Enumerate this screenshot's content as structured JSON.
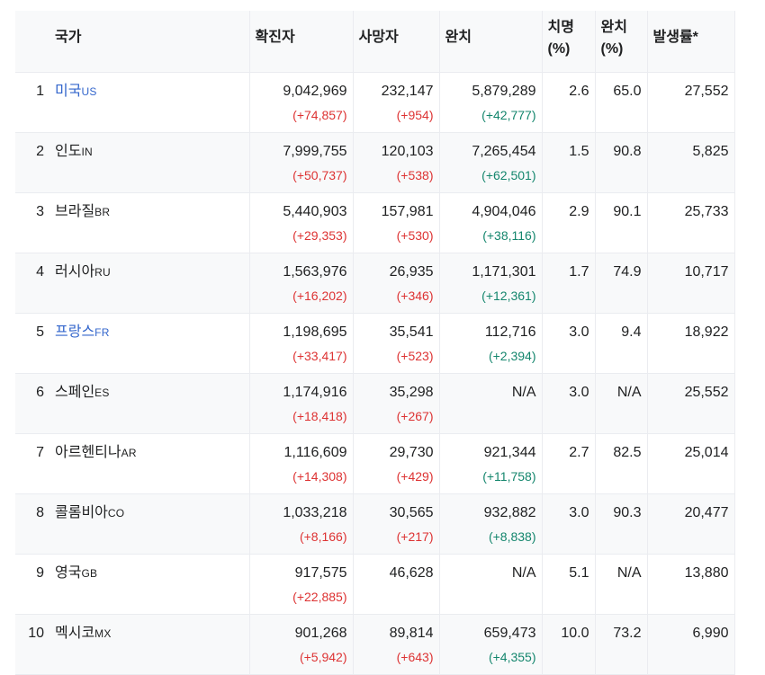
{
  "headers": {
    "country": "국가",
    "confirmed": "확진자",
    "deaths": "사망자",
    "recovered": "완치",
    "fatality_line1": "치명",
    "fatality_line2": "(%)",
    "recovery_line1": "완치",
    "recovery_line2": "(%)",
    "incidence": "발생률*"
  },
  "rows": [
    {
      "rank": "1",
      "name": "미국",
      "code": "US",
      "link": true,
      "confirmed": "9,042,969",
      "confirmed_delta": "(+74,857)",
      "deaths": "232,147",
      "deaths_delta": "(+954)",
      "recovered": "5,879,289",
      "recovered_delta": "(+42,777)",
      "fatality": "2.6",
      "recovery_rate": "65.0",
      "incidence": "27,552"
    },
    {
      "rank": "2",
      "name": "인도",
      "code": "IN",
      "link": false,
      "confirmed": "7,999,755",
      "confirmed_delta": "(+50,737)",
      "deaths": "120,103",
      "deaths_delta": "(+538)",
      "recovered": "7,265,454",
      "recovered_delta": "(+62,501)",
      "fatality": "1.5",
      "recovery_rate": "90.8",
      "incidence": "5,825"
    },
    {
      "rank": "3",
      "name": "브라질",
      "code": "BR",
      "link": false,
      "confirmed": "5,440,903",
      "confirmed_delta": "(+29,353)",
      "deaths": "157,981",
      "deaths_delta": "(+530)",
      "recovered": "4,904,046",
      "recovered_delta": "(+38,116)",
      "fatality": "2.9",
      "recovery_rate": "90.1",
      "incidence": "25,733"
    },
    {
      "rank": "4",
      "name": "러시아",
      "code": "RU",
      "link": false,
      "confirmed": "1,563,976",
      "confirmed_delta": "(+16,202)",
      "deaths": "26,935",
      "deaths_delta": "(+346)",
      "recovered": "1,171,301",
      "recovered_delta": "(+12,361)",
      "fatality": "1.7",
      "recovery_rate": "74.9",
      "incidence": "10,717"
    },
    {
      "rank": "5",
      "name": "프랑스",
      "code": "FR",
      "link": true,
      "confirmed": "1,198,695",
      "confirmed_delta": "(+33,417)",
      "deaths": "35,541",
      "deaths_delta": "(+523)",
      "recovered": "112,716",
      "recovered_delta": "(+2,394)",
      "fatality": "3.0",
      "recovery_rate": "9.4",
      "incidence": "18,922"
    },
    {
      "rank": "6",
      "name": "스페인",
      "code": "ES",
      "link": false,
      "confirmed": "1,174,916",
      "confirmed_delta": "(+18,418)",
      "deaths": "35,298",
      "deaths_delta": "(+267)",
      "recovered": "N/A",
      "recovered_delta": "",
      "fatality": "3.0",
      "recovery_rate": "N/A",
      "incidence": "25,552"
    },
    {
      "rank": "7",
      "name": "아르헨티나",
      "code": "AR",
      "link": false,
      "confirmed": "1,116,609",
      "confirmed_delta": "(+14,308)",
      "deaths": "29,730",
      "deaths_delta": "(+429)",
      "recovered": "921,344",
      "recovered_delta": "(+11,758)",
      "fatality": "2.7",
      "recovery_rate": "82.5",
      "incidence": "25,014"
    },
    {
      "rank": "8",
      "name": "콜롬비아",
      "code": "CO",
      "link": false,
      "confirmed": "1,033,218",
      "confirmed_delta": "(+8,166)",
      "deaths": "30,565",
      "deaths_delta": "(+217)",
      "recovered": "932,882",
      "recovered_delta": "(+8,838)",
      "fatality": "3.0",
      "recovery_rate": "90.3",
      "incidence": "20,477"
    },
    {
      "rank": "9",
      "name": "영국",
      "code": "GB",
      "link": false,
      "confirmed": "917,575",
      "confirmed_delta": "(+22,885)",
      "deaths": "46,628",
      "deaths_delta": "",
      "recovered": "N/A",
      "recovered_delta": "",
      "fatality": "5.1",
      "recovery_rate": "N/A",
      "incidence": "13,880"
    },
    {
      "rank": "10",
      "name": "멕시코",
      "code": "MX",
      "link": false,
      "confirmed": "901,268",
      "confirmed_delta": "(+5,942)",
      "deaths": "89,814",
      "deaths_delta": "(+643)",
      "recovered": "659,473",
      "recovered_delta": "(+4,355)",
      "fatality": "10.0",
      "recovery_rate": "73.2",
      "incidence": "6,990"
    }
  ],
  "colors": {
    "link": "#3366cc",
    "increase": "#dd3333",
    "recovered_increase": "#14866d",
    "header_bg": "#f8f9fa",
    "stripe_bg": "#f8f9fa"
  }
}
